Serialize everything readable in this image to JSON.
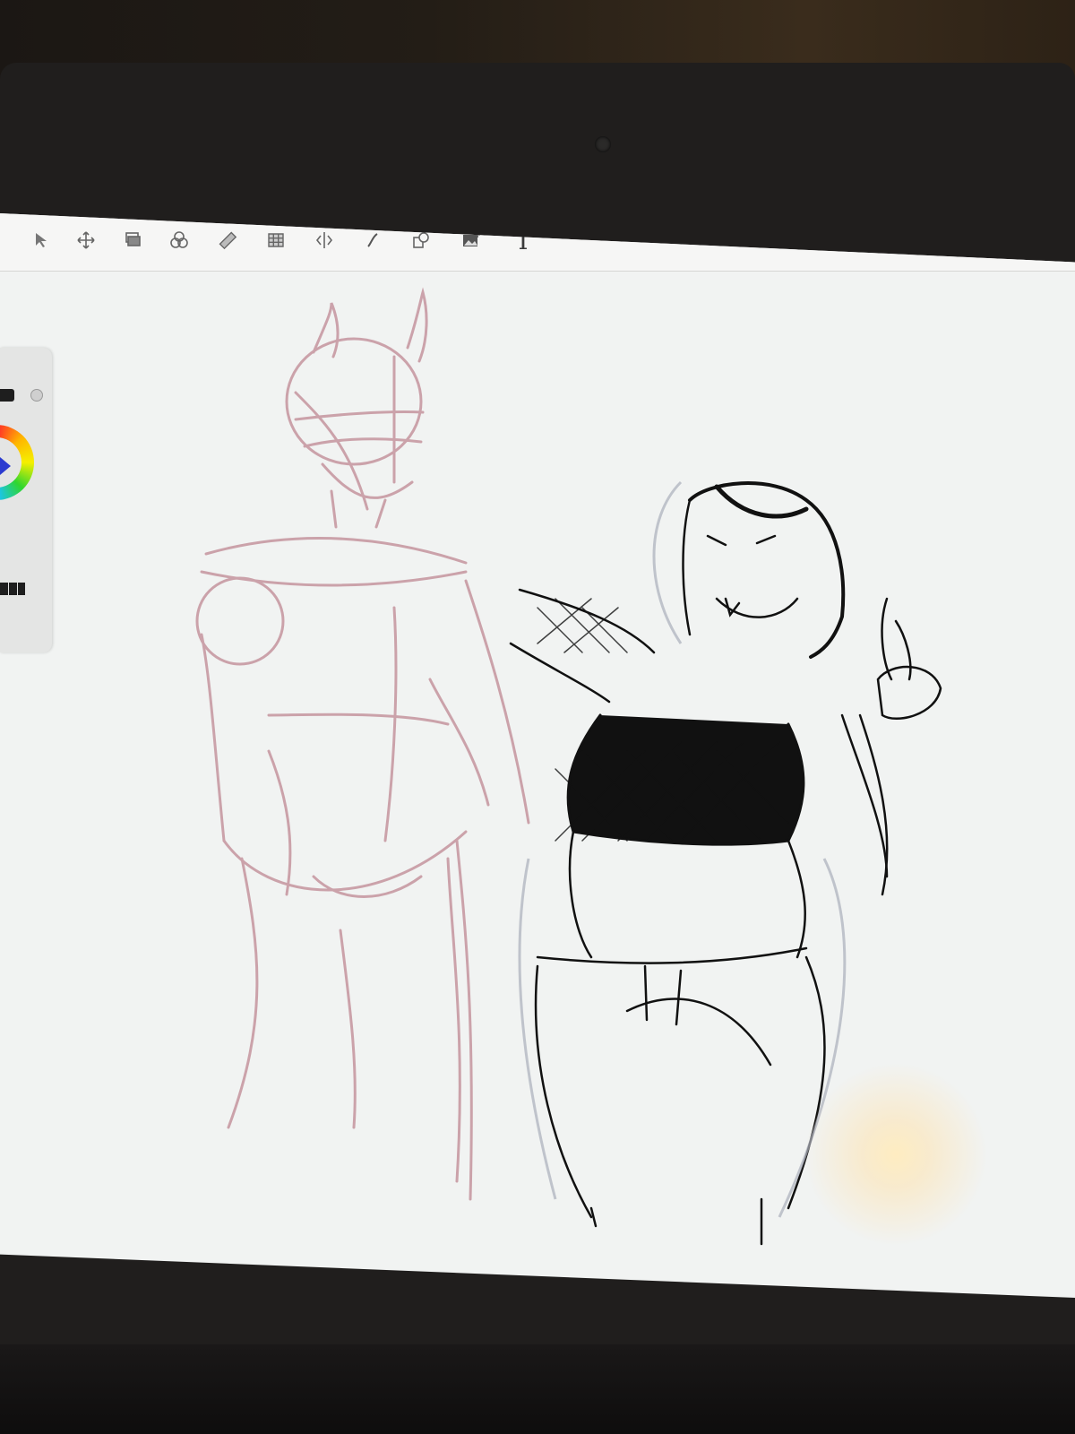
{
  "toolbar": {
    "tools": [
      {
        "icon": "select-arrow-icon"
      },
      {
        "icon": "move-transform-icon"
      },
      {
        "icon": "layers-icon"
      },
      {
        "icon": "blend-circles-icon"
      },
      {
        "icon": "ruler-icon"
      },
      {
        "icon": "perspective-grid-icon"
      },
      {
        "icon": "symmetry-icon"
      },
      {
        "icon": "stroke-curve-icon"
      },
      {
        "icon": "shapes-icon"
      },
      {
        "icon": "insert-image-icon"
      },
      {
        "icon": "text-tool-icon",
        "label": "T"
      }
    ]
  },
  "side_panel": {
    "primary_color": "#1e1e1e",
    "wheel_pointer_color": "#2b3bd0"
  },
  "canvas": {
    "background": "#f1f3f2",
    "figures": [
      {
        "name": "horned-figure-sketch",
        "ink": "#c79aa3"
      },
      {
        "name": "posing-figure-drawing",
        "ink": "#111111"
      }
    ]
  }
}
